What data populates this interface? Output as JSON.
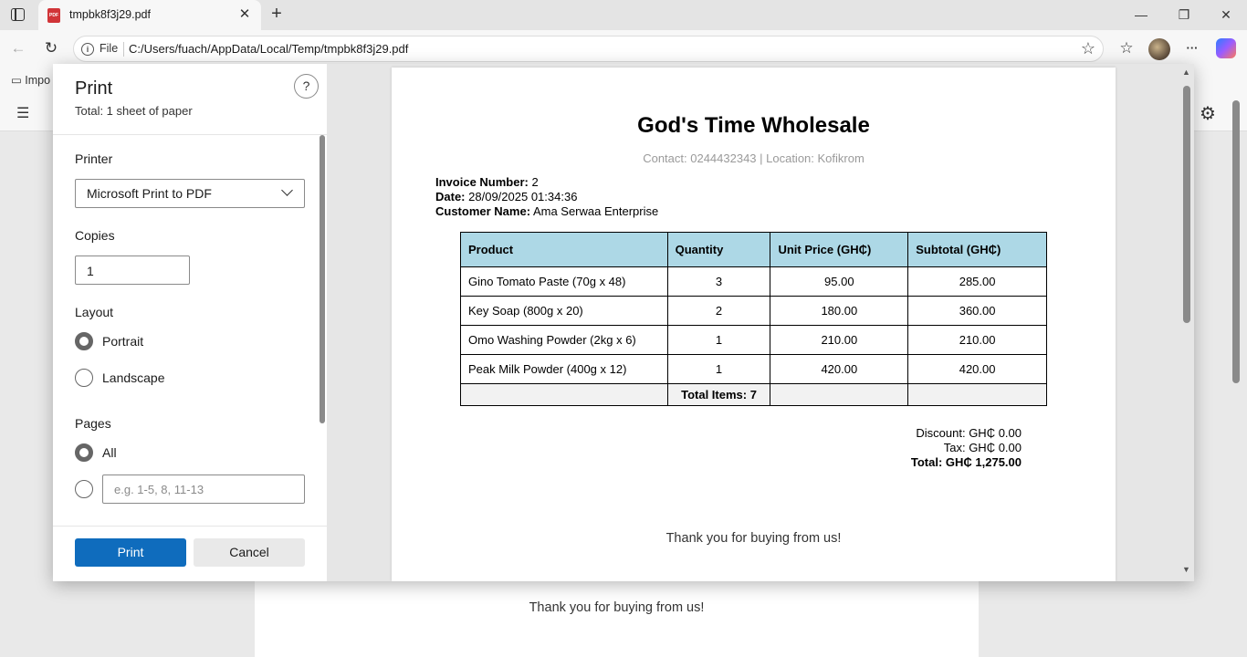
{
  "browser": {
    "tab_title": "tmpbk8f3j29.pdf",
    "tab_pdf_badge": "PDF",
    "address_scheme": "File",
    "url": "C:/Users/fuach/AppData/Local/Temp/tmpbk8f3j29.pdf",
    "favorites_item": "Impo",
    "icons": {
      "back": "←",
      "reload": "↻",
      "star": "☆",
      "favorites": "☆",
      "more": "···",
      "minimize": "—",
      "restore": "❐",
      "close": "✕",
      "newtab": "+",
      "tab_close": "✕",
      "settings": "⚙",
      "list": "☰",
      "help": "?",
      "info": "i"
    }
  },
  "print_dialog": {
    "title": "Print",
    "total": "Total: 1 sheet of paper",
    "printer_label": "Printer",
    "printer_value": "Microsoft Print to PDF",
    "copies_label": "Copies",
    "copies_value": "1",
    "layout_label": "Layout",
    "layout_options": [
      "Portrait",
      "Landscape"
    ],
    "layout_selected": "Portrait",
    "pages_label": "Pages",
    "pages_all": "All",
    "pages_placeholder": "e.g. 1-5, 8, 11-13",
    "print_button": "Print",
    "cancel_button": "Cancel",
    "accent_color": "#0f6cbd"
  },
  "invoice": {
    "business_name": "God's Time Wholesale",
    "contact_line": "Contact: 0244432343 | Location: Kofikrom",
    "invoice_number_label": "Invoice Number:",
    "invoice_number": "2",
    "date_label": "Date:",
    "date": "28/09/2025 01:34:36",
    "customer_label": "Customer Name:",
    "customer": "Ama Serwaa Enterprise",
    "columns": [
      "Product",
      "Quantity",
      "Unit Price (GH₵)",
      "Subtotal (GH₵)"
    ],
    "rows": [
      {
        "product": "Gino Tomato Paste (70g x 48)",
        "qty": "3",
        "unit": "95.00",
        "subtotal": "285.00"
      },
      {
        "product": "Key Soap (800g x 20)",
        "qty": "2",
        "unit": "180.00",
        "subtotal": "360.00"
      },
      {
        "product": "Omo Washing Powder (2kg x 6)",
        "qty": "1",
        "unit": "210.00",
        "subtotal": "210.00"
      },
      {
        "product": "Peak Milk Powder (400g x 12)",
        "qty": "1",
        "unit": "420.00",
        "subtotal": "420.00"
      }
    ],
    "total_items": "Total Items: 7",
    "discount": "Discount: GH₵ 0.00",
    "tax": "Tax: GH₵ 0.00",
    "grand_total": "Total: GH₵ 1,275.00",
    "thanks": "Thank you for buying from us!",
    "header_color": "#add8e6"
  }
}
